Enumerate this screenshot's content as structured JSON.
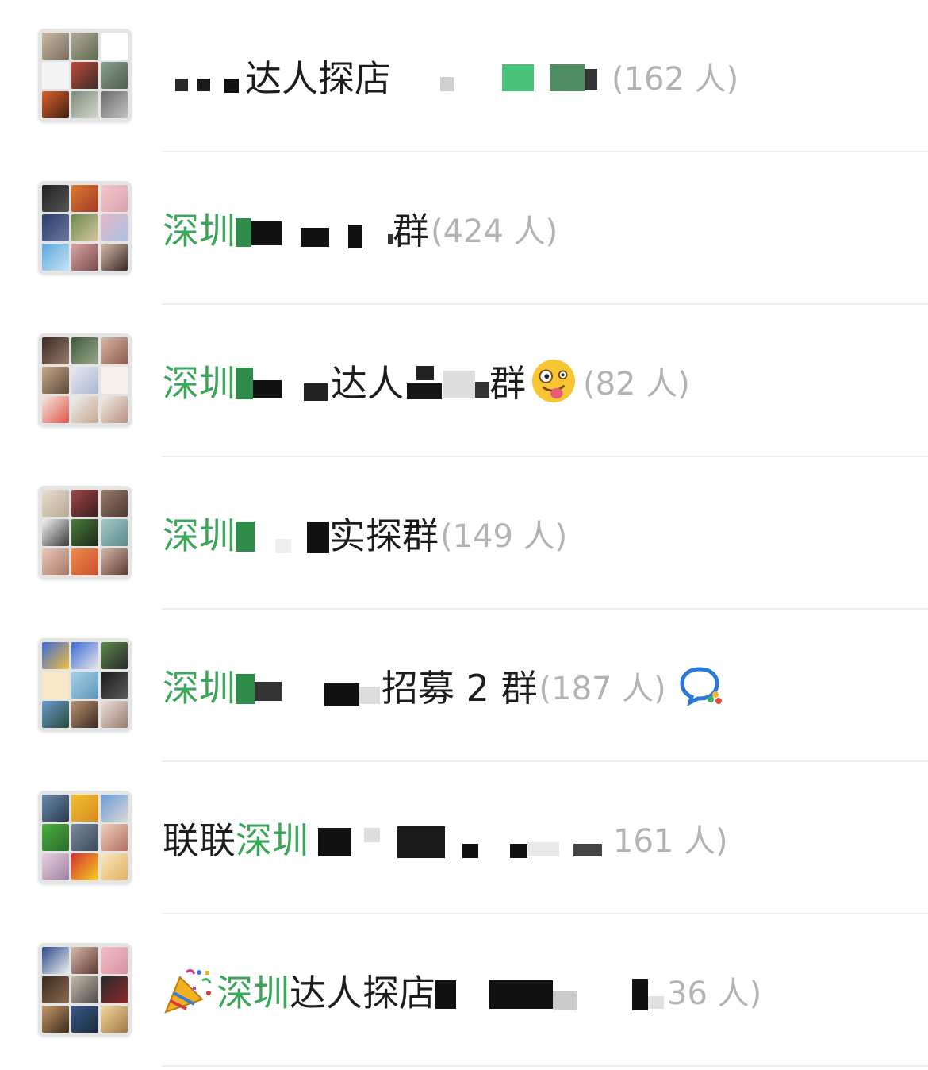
{
  "groups": [
    {
      "name_before": "",
      "name_green": "",
      "name_after": "达人探店",
      "count": "(162 人)"
    },
    {
      "name_before": "",
      "name_green": "深圳",
      "name_after": "群",
      "count": "(424 人)"
    },
    {
      "name_before": "",
      "name_green": "深圳",
      "name_after": "达人",
      "name_tail": "群",
      "count": "(82 人)"
    },
    {
      "name_before": "",
      "name_green": "深圳",
      "name_after": "实探群",
      "count": "(149 人)"
    },
    {
      "name_before": "",
      "name_green": "深圳",
      "name_after": "招募 2 群",
      "count": "(187 人)"
    },
    {
      "name_before": "联联",
      "name_green": "深圳",
      "name_after": "",
      "count": "161 人)"
    },
    {
      "name_before": "",
      "name_green": "深圳",
      "name_after": "达人探店",
      "count": "36 人)"
    }
  ],
  "icons": [
    "group-avatar-icon",
    "grinning-squinting-face-icon",
    "chat-bubble-icon",
    "party-popper-icon"
  ],
  "colors": {
    "accent_green": "#3aa657",
    "count_gray": "#b3b3b3",
    "divider": "#ececec"
  }
}
